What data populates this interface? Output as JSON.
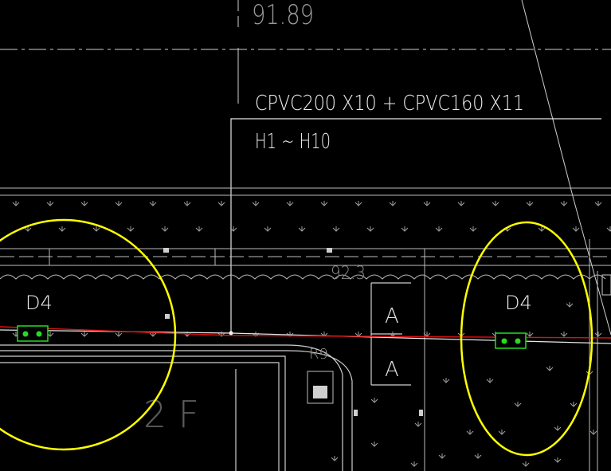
{
  "labels": {
    "elevation_top": "91.89",
    "elevation_mid": "92.3",
    "cable_spec": "CPVC200 X10 + CPVC160 X11",
    "cable_range": "H1 ~ H10",
    "duct_left": "D4",
    "duct_right": "D4",
    "section_upper": "A",
    "section_lower": "A",
    "room_tag": "R9",
    "floor_tag": "2 F"
  },
  "colors": {
    "background": "#000000",
    "linework": "#d9d9d9",
    "highlight_circle": "#ffff00",
    "cable_route": "#e01010",
    "handhole": "#22dd22"
  },
  "icons": {
    "handhole_left": "handhole-icon",
    "handhole_right": "handhole-icon",
    "equipment": "equipment-box-icon",
    "drain_arrow": "down-arrow-icon"
  }
}
